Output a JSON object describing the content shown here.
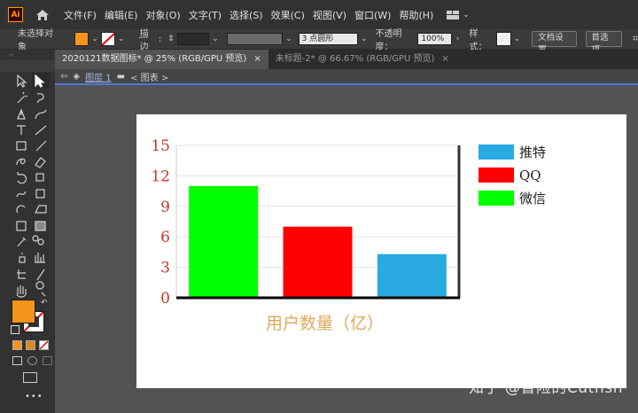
{
  "menubar": {
    "app_logo": "Ai",
    "items": [
      "文件(F)",
      "编辑(E)",
      "对象(O)",
      "文字(T)",
      "选择(S)",
      "效果(C)",
      "视图(V)",
      "窗口(W)",
      "帮助(H)"
    ]
  },
  "control_bar": {
    "no_selection": "未选择对象",
    "fill_color": "#f7941d",
    "stroke_label": "描边",
    "brush_label": "3 点圆形",
    "opacity_label": "不透明度：",
    "opacity_value": "100%",
    "style_label": "样式：",
    "doc_setup": "文档设置",
    "preferences": "首选项"
  },
  "tabs": [
    {
      "label": "2020121数据图标* @ 25% (RGB/GPU 预览)",
      "close": "×"
    },
    {
      "label": "未标题-2* @ 66.67% (RGB/GPU 预览)",
      "close": "×"
    }
  ],
  "breadcrumb": {
    "layer": "图层 1",
    "item": "< 图表 >"
  },
  "toolbar": {
    "fill_color": "#f7941d",
    "more": "•••"
  },
  "chart_data": {
    "type": "bar",
    "categories": [
      "推特",
      "QQ",
      "微信"
    ],
    "values": [
      4.3,
      7,
      11
    ],
    "draw_order": [
      2,
      1,
      0
    ],
    "colors": [
      "#29abe2",
      "#ff0000",
      "#00ff00"
    ],
    "yticks": [
      "0",
      "3",
      "6",
      "9",
      "12",
      "15"
    ],
    "ylim": [
      0,
      15
    ],
    "xlabel": "用户数量（亿）",
    "legend": [
      "推特",
      "QQ",
      "微信"
    ],
    "legend_position": "right"
  },
  "watermark": "知乎 @冒险的Cutfish"
}
